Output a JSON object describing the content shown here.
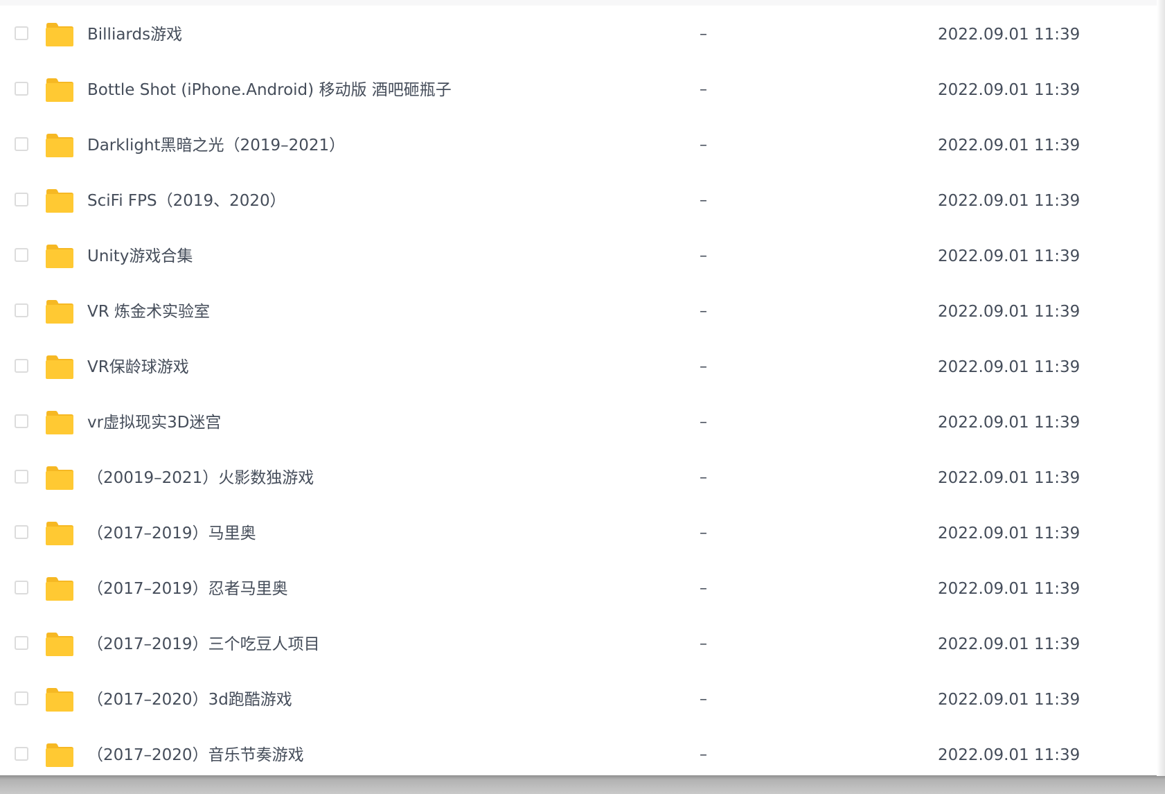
{
  "rows": [
    {
      "name": "Billiards游戏",
      "size": "–",
      "date": "2022.09.01 11:39"
    },
    {
      "name": "Bottle Shot (iPhone.Android) 移动版 酒吧砸瓶子",
      "size": "–",
      "date": "2022.09.01 11:39"
    },
    {
      "name": "Darklight黑暗之光（2019–2021）",
      "size": "–",
      "date": "2022.09.01 11:39"
    },
    {
      "name": "SciFi FPS（2019、2020）",
      "size": "–",
      "date": "2022.09.01 11:39"
    },
    {
      "name": "Unity游戏合集",
      "size": "–",
      "date": "2022.09.01 11:39"
    },
    {
      "name": "VR 炼金术实验室",
      "size": "–",
      "date": "2022.09.01 11:39"
    },
    {
      "name": "VR保龄球游戏",
      "size": "–",
      "date": "2022.09.01 11:39"
    },
    {
      "name": "vr虚拟现实3D迷宫",
      "size": "–",
      "date": "2022.09.01 11:39"
    },
    {
      "name": "（20019–2021）火影数独游戏",
      "size": "–",
      "date": "2022.09.01 11:39"
    },
    {
      "name": "（2017–2019）马里奥",
      "size": "–",
      "date": "2022.09.01 11:39"
    },
    {
      "name": "（2017–2019）忍者马里奥",
      "size": "–",
      "date": "2022.09.01 11:39"
    },
    {
      "name": "（2017–2019）三个吃豆人项目",
      "size": "–",
      "date": "2022.09.01 11:39"
    },
    {
      "name": "（2017–2020）3d跑酷游戏",
      "size": "–",
      "date": "2022.09.01 11:39"
    },
    {
      "name": "（2017–2020）音乐节奏游戏",
      "size": "–",
      "date": "2022.09.01 11:39"
    }
  ],
  "icons": {
    "folder": "folder-icon",
    "checkbox": "checkbox"
  },
  "colors": {
    "folder_body": "#ffc933",
    "folder_tab": "#f6b823",
    "text": "#454d5a",
    "checkbox_border": "#dcdcdc"
  }
}
